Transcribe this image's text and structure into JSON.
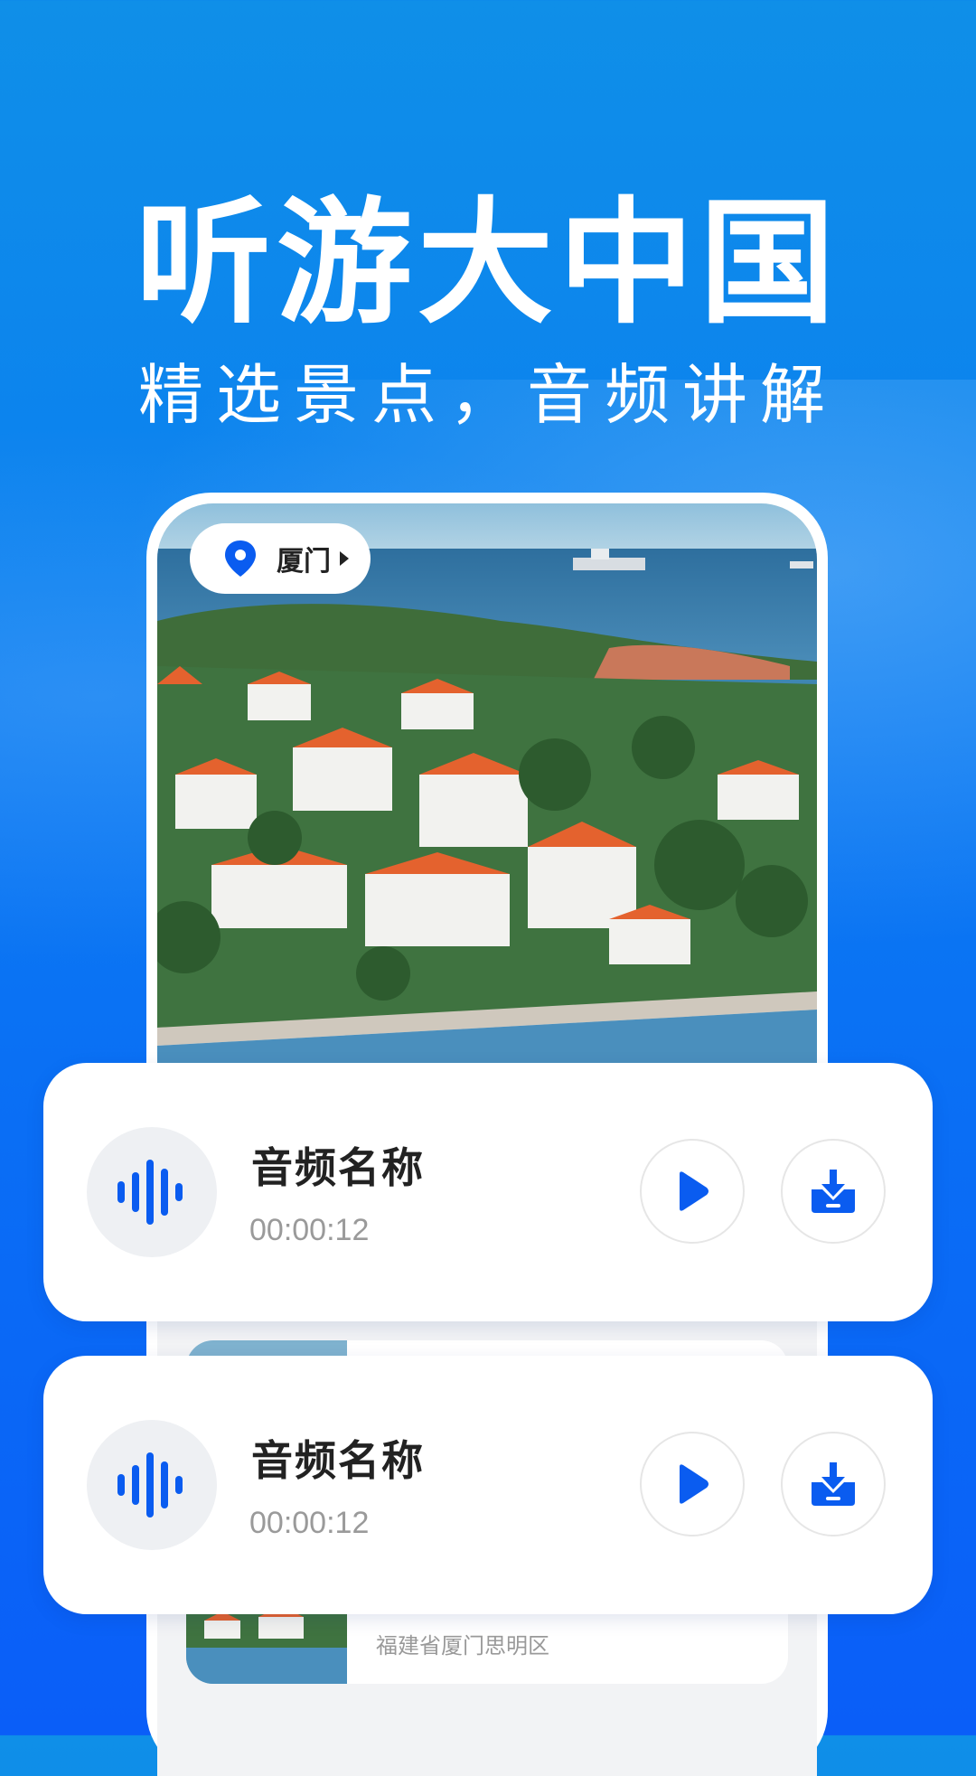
{
  "promo": {
    "headline": "听游大中国",
    "subhead": "精选景点，音频讲解"
  },
  "phone": {
    "location_label": "厦门",
    "list_card": {
      "address": "福建省厦门思明区"
    }
  },
  "audio_cards": [
    {
      "name": "音频名称",
      "duration": "00:00:12"
    },
    {
      "name": "音频名称",
      "duration": "00:00:12"
    }
  ],
  "colors": {
    "accent_blue": "#0a5cf0",
    "background_top": "#0f8fe8",
    "background_bottom": "#0a5ef8"
  },
  "icons": [
    "location-pin-icon",
    "chevron-right-icon",
    "audio-wave-icon",
    "play-icon",
    "download-icon"
  ]
}
